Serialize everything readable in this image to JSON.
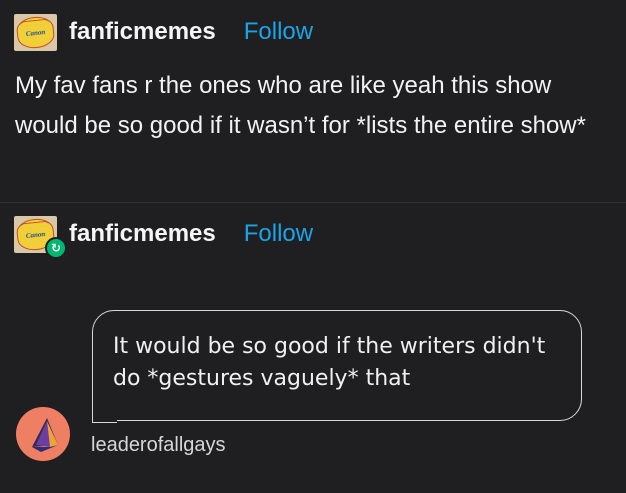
{
  "posts": [
    {
      "username": "fanficmemes",
      "follow_label": "Follow",
      "avatar_text": "I Can't Believe It's Not Canon",
      "text": "My fav fans r the ones who are like yeah this show would be so good if it wasn’t for *lists the entire show*"
    },
    {
      "username": "fanficmemes",
      "follow_label": "Follow",
      "avatar_text": "I Can't Believe It's Not Canon",
      "reblog_icon": "repeat-icon"
    }
  ],
  "ask": {
    "text": "It would be so good if the writers didn't do *gestures vaguely* that",
    "asker": "leaderofallgays"
  },
  "colors": {
    "background": "#1f1f21",
    "follow": "#1aa4e8",
    "reblog": "#00b76f",
    "text": "#f2f2f2"
  }
}
